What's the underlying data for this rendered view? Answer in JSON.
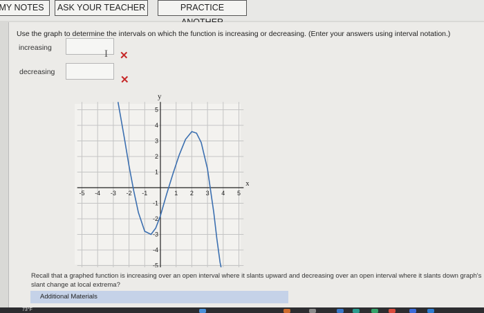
{
  "toolbar": {
    "my_notes": "MY NOTES",
    "ask_teacher": "ASK YOUR TEACHER",
    "practice": "PRACTICE ANOTHER"
  },
  "question": "Use the graph to determine the intervals on which the function is increasing or decreasing. (Enter your answers using interval notation.)",
  "fields": {
    "increasing_label": "increasing",
    "decreasing_label": "decreasing",
    "increasing_value": "",
    "decreasing_value": "",
    "wrong_mark": "✕",
    "cursor": "I"
  },
  "graph": {
    "y_label": "y",
    "x_label": "x",
    "x_ticks": [
      "-5",
      "-4",
      "-3",
      "-2",
      "-1",
      "1",
      "2",
      "3",
      "4",
      "5"
    ],
    "y_ticks": [
      "5",
      "4",
      "3",
      "2",
      "1",
      "-1",
      "-2",
      "-3",
      "-4",
      "-5"
    ]
  },
  "chart_data": {
    "type": "line",
    "xlim": [
      -5.3,
      5.3
    ],
    "ylim": [
      -5.3,
      5.5
    ],
    "grid": true,
    "x": [
      -2.7,
      -2.3,
      -2.0,
      -1.7,
      -1.4,
      -1.0,
      -0.6,
      -0.3,
      0.0,
      0.4,
      0.8,
      1.2,
      1.6,
      2.0,
      2.3,
      2.6,
      3.0,
      3.4,
      3.6,
      3.8,
      4.0
    ],
    "y": [
      5.5,
      3.2,
      1.4,
      -0.2,
      -1.6,
      -2.8,
      -3.0,
      -2.6,
      -1.8,
      -0.4,
      0.9,
      2.1,
      3.1,
      3.6,
      3.5,
      2.9,
      1.2,
      -1.6,
      -3.3,
      -4.8,
      -6.0
    ]
  },
  "hint": "Recall that a graphed function is increasing over an open interval where it slants upward and decreasing over an open interval where it slants down graph's slant change at local extrema?",
  "additional_materials": "Additional Materials",
  "taskbar": {
    "weather": "73°F"
  }
}
